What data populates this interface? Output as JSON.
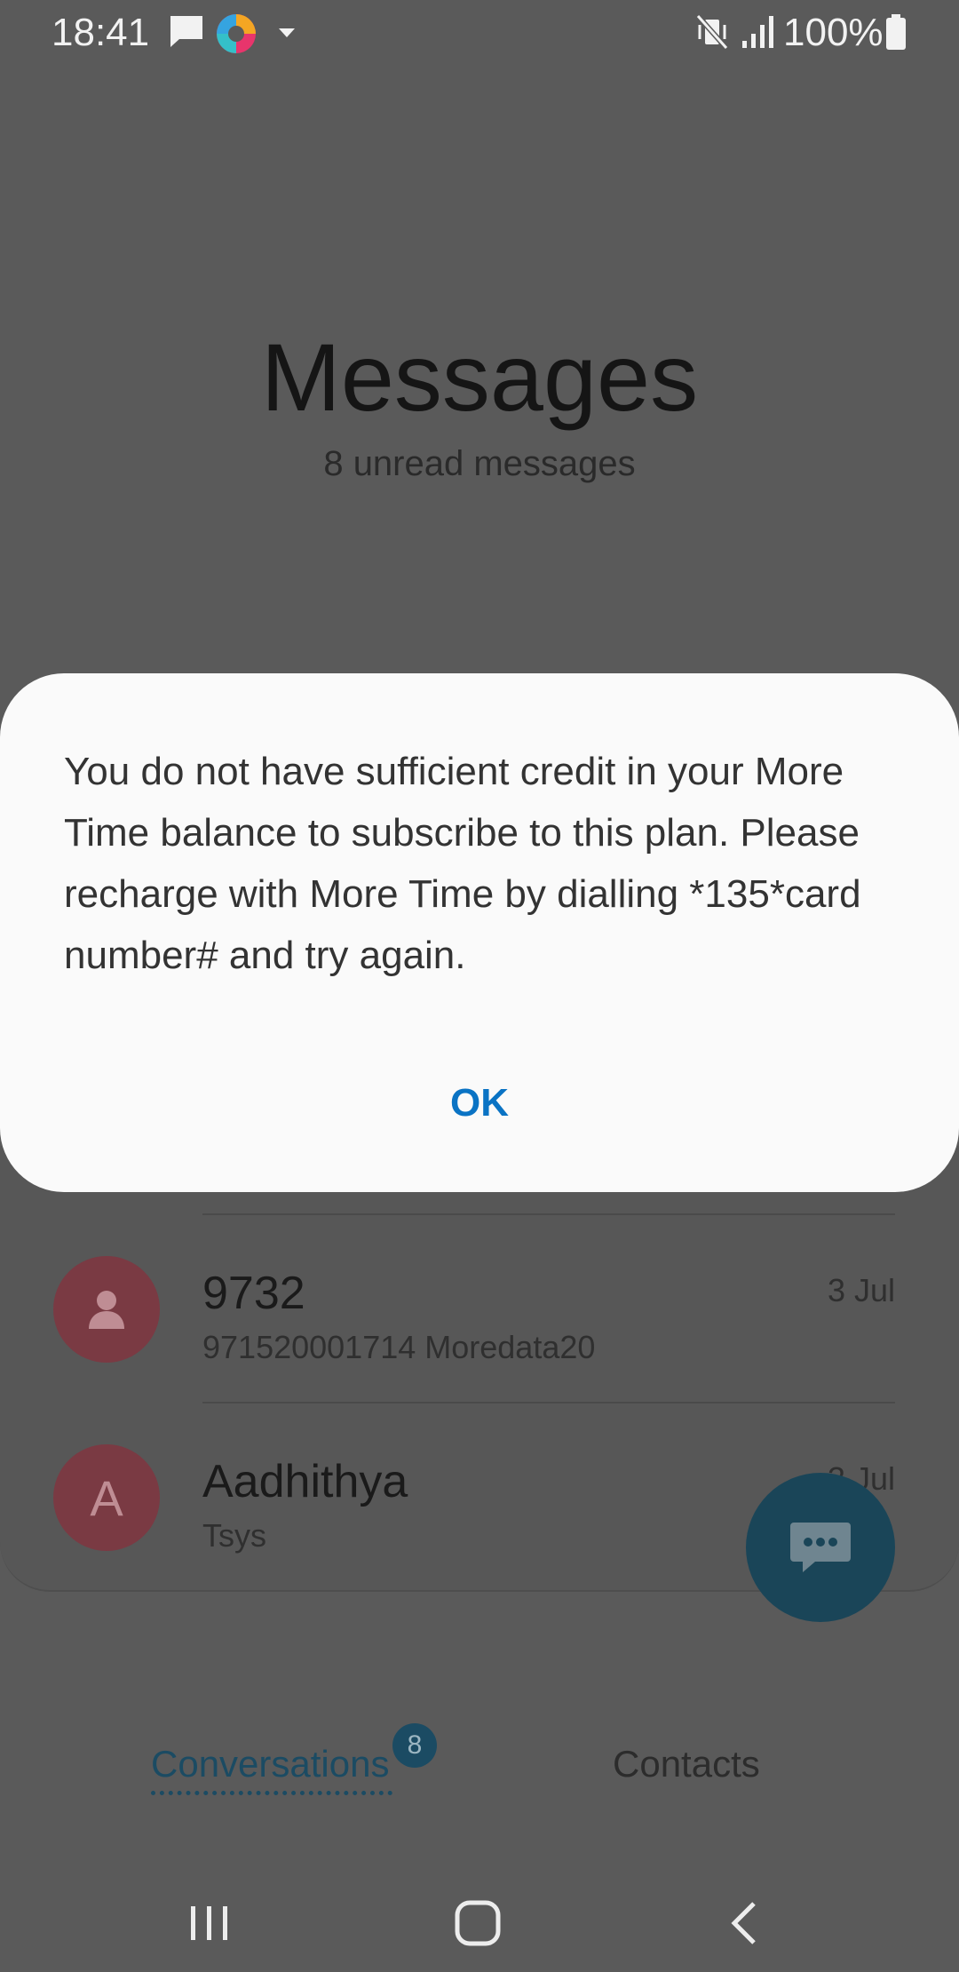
{
  "status_bar": {
    "time": "18:41",
    "battery": "100%",
    "icons": [
      "message-notification-icon",
      "colorful-app-icon",
      "dropdown-arrow-icon",
      "mute-vibrate-icon",
      "signal-icon",
      "battery-icon"
    ]
  },
  "header": {
    "title": "Messages",
    "subtitle": "8 unread messages"
  },
  "conversations": [
    {
      "name": "9732",
      "preview": "971520001714 Moredata20",
      "date": "3 Jul",
      "avatar": "person-icon"
    },
    {
      "name": "Aadhithya",
      "preview": "Tsys",
      "date": "3 Jul",
      "avatar_letter": "A"
    }
  ],
  "tabs": {
    "conversations": "Conversations",
    "conversations_badge": "8",
    "contacts": "Contacts"
  },
  "dialog": {
    "message": "You do not have sufficient credit in your More Time balance to subscribe to this plan. Please recharge with More Time by dialling *135*card number# and try again.",
    "ok": "OK"
  },
  "colors": {
    "accent": "#0a73c4",
    "scrim": "#5a5a5a",
    "dialog_bg": "#fafafa"
  }
}
